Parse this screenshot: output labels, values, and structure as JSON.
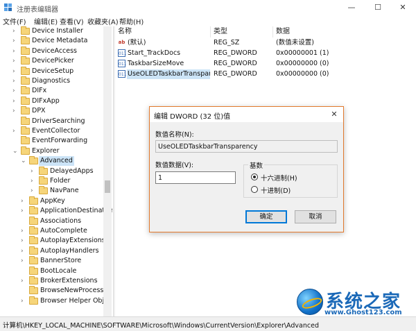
{
  "window": {
    "title": "注册表编辑器",
    "minimize_glyph": "—",
    "maximize_glyph": "☐",
    "close_glyph": "✕"
  },
  "menu": [
    "文件(F)",
    "编辑(E)",
    "查看(V)",
    "收藏夹(A)",
    "帮助(H)"
  ],
  "tree": {
    "items": [
      {
        "label": "Device Installer",
        "level": 1,
        "expander": ">"
      },
      {
        "label": "Device Metadata",
        "level": 1,
        "expander": ">"
      },
      {
        "label": "DeviceAccess",
        "level": 1,
        "expander": ">"
      },
      {
        "label": "DevicePicker",
        "level": 1,
        "expander": ">"
      },
      {
        "label": "DeviceSetup",
        "level": 1,
        "expander": ">"
      },
      {
        "label": "Diagnostics",
        "level": 1,
        "expander": ">"
      },
      {
        "label": "DIFx",
        "level": 1,
        "expander": ">"
      },
      {
        "label": "DIFxApp",
        "level": 1,
        "expander": ">"
      },
      {
        "label": "DPX",
        "level": 1,
        "expander": ">"
      },
      {
        "label": "DriverSearching",
        "level": 1,
        "expander": ""
      },
      {
        "label": "EventCollector",
        "level": 1,
        "expander": ">"
      },
      {
        "label": "EventForwarding",
        "level": 1,
        "expander": ""
      },
      {
        "label": "Explorer",
        "level": 1,
        "expander": "v"
      },
      {
        "label": "Advanced",
        "level": 2,
        "expander": "v",
        "selected": true
      },
      {
        "label": "DelayedApps",
        "level": 3,
        "expander": ">"
      },
      {
        "label": "Folder",
        "level": 3,
        "expander": ">"
      },
      {
        "label": "NavPane",
        "level": 3,
        "expander": ">"
      },
      {
        "label": "AppKey",
        "level": 2,
        "expander": ">"
      },
      {
        "label": "ApplicationDestination",
        "level": 2,
        "expander": ">"
      },
      {
        "label": "Associations",
        "level": 2,
        "expander": ""
      },
      {
        "label": "AutoComplete",
        "level": 2,
        "expander": ">"
      },
      {
        "label": "AutoplayExtensions",
        "level": 2,
        "expander": ">"
      },
      {
        "label": "AutoplayHandlers",
        "level": 2,
        "expander": ">"
      },
      {
        "label": "BannerStore",
        "level": 2,
        "expander": ">"
      },
      {
        "label": "BootLocale",
        "level": 2,
        "expander": ""
      },
      {
        "label": "BrokerExtensions",
        "level": 2,
        "expander": ">"
      },
      {
        "label": "BrowseNewProcess",
        "level": 2,
        "expander": ""
      },
      {
        "label": "Browser Helper Obje",
        "level": 2,
        "expander": ">"
      }
    ]
  },
  "values_table": {
    "headers": {
      "name": "名称",
      "type": "类型",
      "data": "数据"
    },
    "rows": [
      {
        "name": "(默认)",
        "type": "REG_SZ",
        "data": "(数值未设置)",
        "icon": "ab"
      },
      {
        "name": "Start_TrackDocs",
        "type": "REG_DWORD",
        "data": "0x00000001 (1)",
        "icon": "011"
      },
      {
        "name": "TaskbarSizeMove",
        "type": "REG_DWORD",
        "data": "0x00000000 (0)",
        "icon": "011"
      },
      {
        "name": "UseOLEDTaskbarTranspar...",
        "type": "REG_DWORD",
        "data": "0x00000000 (0)",
        "icon": "011",
        "selected": true
      }
    ]
  },
  "status_bar": {
    "path": "计算机\\HKEY_LOCAL_MACHINE\\SOFTWARE\\Microsoft\\Windows\\CurrentVersion\\Explorer\\Advanced"
  },
  "dialog": {
    "title": "编辑 DWORD (32 位)值",
    "close_glyph": "✕",
    "value_name_label": "数值名称(N):",
    "value_name": "UseOLEDTaskbarTransparency",
    "value_data_label": "数值数据(V):",
    "value_data": "1",
    "base_group_label": "基数",
    "base_options": [
      {
        "label": "十六进制(H)",
        "selected": true
      },
      {
        "label": "十进制(D)",
        "selected": false
      }
    ],
    "ok_label": "确定",
    "cancel_label": "取消"
  },
  "watermark": {
    "brand": "系统之家",
    "url": "www.Ghost123.com"
  },
  "colors": {
    "selection": "#cce4f7",
    "dialog_border": "#e2792c",
    "default_button_border": "#0078d7"
  }
}
